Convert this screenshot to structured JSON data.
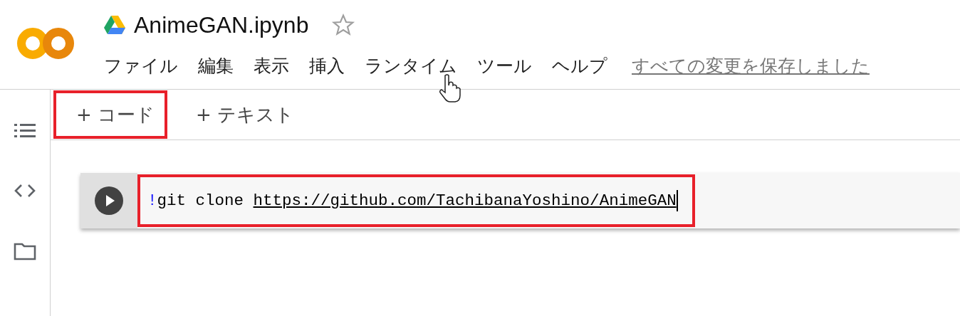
{
  "header": {
    "title": "AnimeGAN.ipynb",
    "starred": false,
    "menu": [
      "ファイル",
      "編集",
      "表示",
      "挿入",
      "ランタイム",
      "ツール",
      "ヘルプ"
    ],
    "save_status": "すべての変更を保存しました"
  },
  "toolbar": [
    {
      "label": "+ コード",
      "highlighted": true
    },
    {
      "label": "+ テキスト",
      "highlighted": false
    }
  ],
  "cell": {
    "highlighted": true,
    "code": {
      "bang": "!",
      "command": "git clone ",
      "link": "https://github.com/TachibanaYoshino/AnimeGAN"
    }
  }
}
